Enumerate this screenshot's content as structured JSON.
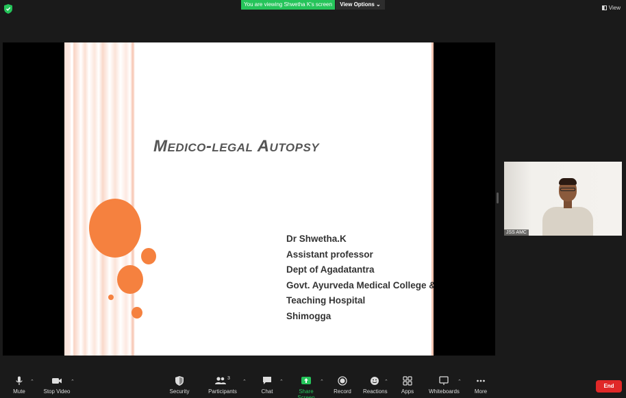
{
  "banner": {
    "text": "You are viewing Shwetha K's screen"
  },
  "view_options": {
    "label": "View Options ⌄"
  },
  "view": {
    "label": "View"
  },
  "slide": {
    "title": "Medico-legal Autopsy",
    "author_lines": [
      "Dr Shwetha.K",
      "Assistant professor",
      "Dept of Agadatantra",
      "Govt. Ayurveda Medical College &",
      "Teaching Hospital",
      "Shimogga"
    ]
  },
  "participant_video": {
    "label": "JSS AMC"
  },
  "toolbar": {
    "mute": "Mute",
    "stop_video": "Stop Video",
    "security": "Security",
    "participants": "Participants",
    "participants_count": "3",
    "chat": "Chat",
    "share_screen": "Share Screen",
    "record": "Record",
    "reactions": "Reactions",
    "apps": "Apps",
    "whiteboards": "Whiteboards",
    "more": "More",
    "end": "End"
  },
  "colors": {
    "accent_green": "#25c45a",
    "end_red": "#e02828",
    "slide_orange": "#f5813f"
  }
}
